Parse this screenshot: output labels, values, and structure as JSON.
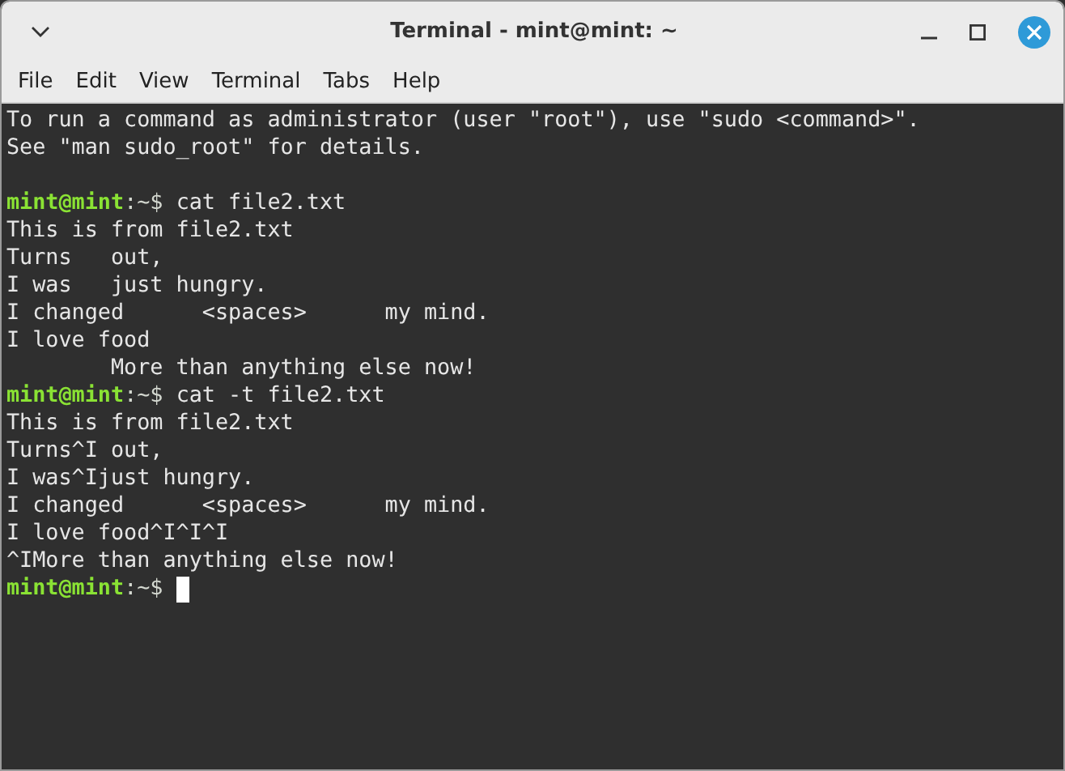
{
  "window": {
    "title": "Terminal - mint@mint: ~"
  },
  "menu": [
    "File",
    "Edit",
    "View",
    "Terminal",
    "Tabs",
    "Help"
  ],
  "terminal": {
    "lines": [
      {
        "kind": "text",
        "text": "To run a command as administrator (user \"root\"), use \"sudo <command>\"."
      },
      {
        "kind": "text",
        "text": "See \"man sudo_root\" for details."
      },
      {
        "kind": "blank"
      },
      {
        "kind": "prompt",
        "user": "mint@mint",
        "path": ":~$",
        "command": "cat file2.txt"
      },
      {
        "kind": "text",
        "text": "This is from file2.txt"
      },
      {
        "kind": "text",
        "text": "Turns   out,"
      },
      {
        "kind": "text",
        "text": "I was   just hungry."
      },
      {
        "kind": "text",
        "text": "I changed      <spaces>      my mind."
      },
      {
        "kind": "text",
        "text": "I love food"
      },
      {
        "kind": "text",
        "text": "        More than anything else now!"
      },
      {
        "kind": "prompt",
        "user": "mint@mint",
        "path": ":~$",
        "command": "cat -t file2.txt"
      },
      {
        "kind": "text",
        "text": "This is from file2.txt"
      },
      {
        "kind": "text",
        "text": "Turns^I out,"
      },
      {
        "kind": "text",
        "text": "I was^Ijust hungry."
      },
      {
        "kind": "text",
        "text": "I changed      <spaces>      my mind."
      },
      {
        "kind": "text",
        "text": "I love food^I^I^I"
      },
      {
        "kind": "text",
        "text": "^IMore than anything else now!"
      },
      {
        "kind": "prompt",
        "user": "mint@mint",
        "path": ":~$",
        "cursor": true
      }
    ]
  }
}
